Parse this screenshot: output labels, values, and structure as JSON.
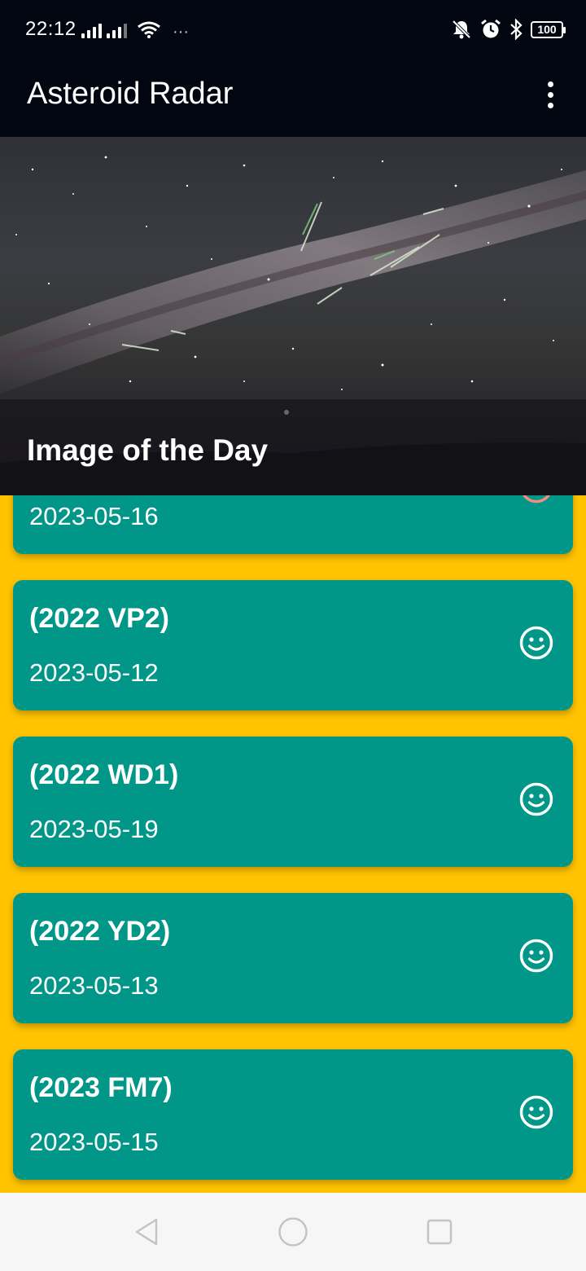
{
  "status_bar": {
    "time": "22:12",
    "battery": "100",
    "icons": [
      "signal-icon",
      "signal-icon",
      "wifi-icon",
      "more-dots-icon",
      "mute-icon",
      "alarm-icon",
      "bluetooth-icon",
      "battery-icon"
    ]
  },
  "app_bar": {
    "title": "Asteroid Radar",
    "menu_icon": "more-vert-icon"
  },
  "image_of_day": {
    "caption": "Image of the Day"
  },
  "asteroids": [
    {
      "name": "",
      "date": "2023-05-16",
      "status": "hazardous"
    },
    {
      "name": "(2022 VP2)",
      "date": "2023-05-12",
      "status": "safe"
    },
    {
      "name": "(2022 WD1)",
      "date": "2023-05-19",
      "status": "safe"
    },
    {
      "name": "(2022 YD2)",
      "date": "2023-05-13",
      "status": "safe"
    },
    {
      "name": "(2023 FM7)",
      "date": "2023-05-15",
      "status": "safe"
    }
  ],
  "nav_bar": {
    "buttons": [
      "back-icon",
      "home-icon",
      "recents-icon"
    ]
  },
  "colors": {
    "app_bar": "#020611",
    "background": "#FFC300",
    "card": "#009688",
    "text": "#FFFFFF",
    "hazard_icon": "#F28B82"
  }
}
